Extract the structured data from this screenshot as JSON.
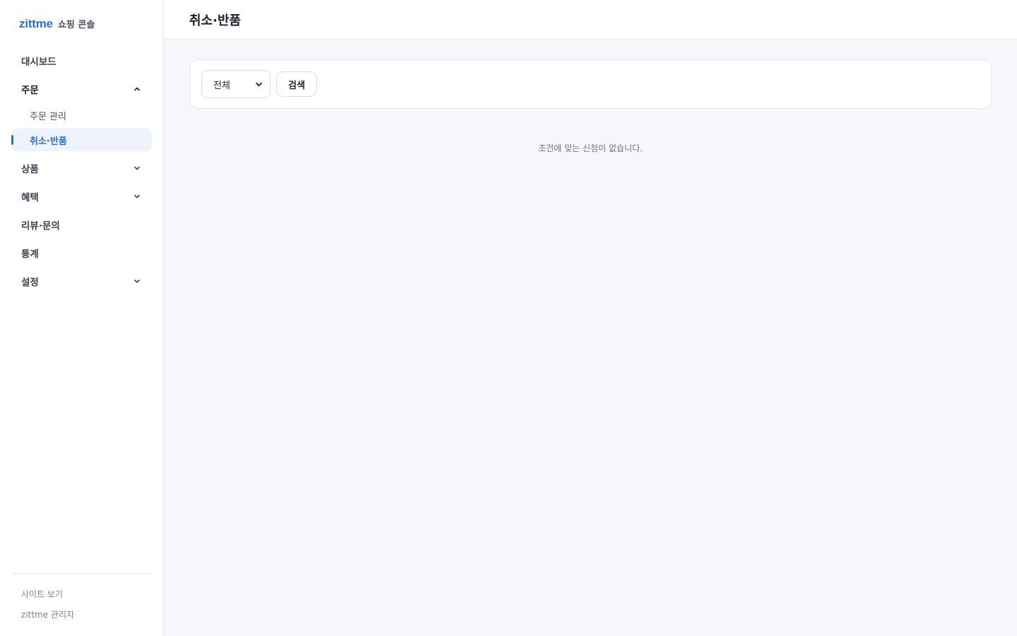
{
  "brand": {
    "logo": "zittme",
    "subtitle": "쇼핑 콘솔"
  },
  "nav": {
    "dashboard": "대시보드",
    "orders": {
      "label": "주문",
      "children": [
        "주문 관리",
        "취소·반품"
      ]
    },
    "products": "상품",
    "benefits": "혜택",
    "reviews": "리뷰·문의",
    "stats": "통계",
    "settings": "설정"
  },
  "footer": {
    "view_site": "사이트 보기",
    "admin": "zittme 관리자"
  },
  "header": {
    "title": "취소·반품"
  },
  "filter": {
    "select_value": "전체",
    "search_label": "검색"
  },
  "empty_message": "조건에 맞는 신청이 없습니다.",
  "colors": {
    "accent": "#2b6fd6",
    "active_bg": "#eef3fd",
    "page_bg": "#f5f7fb"
  }
}
